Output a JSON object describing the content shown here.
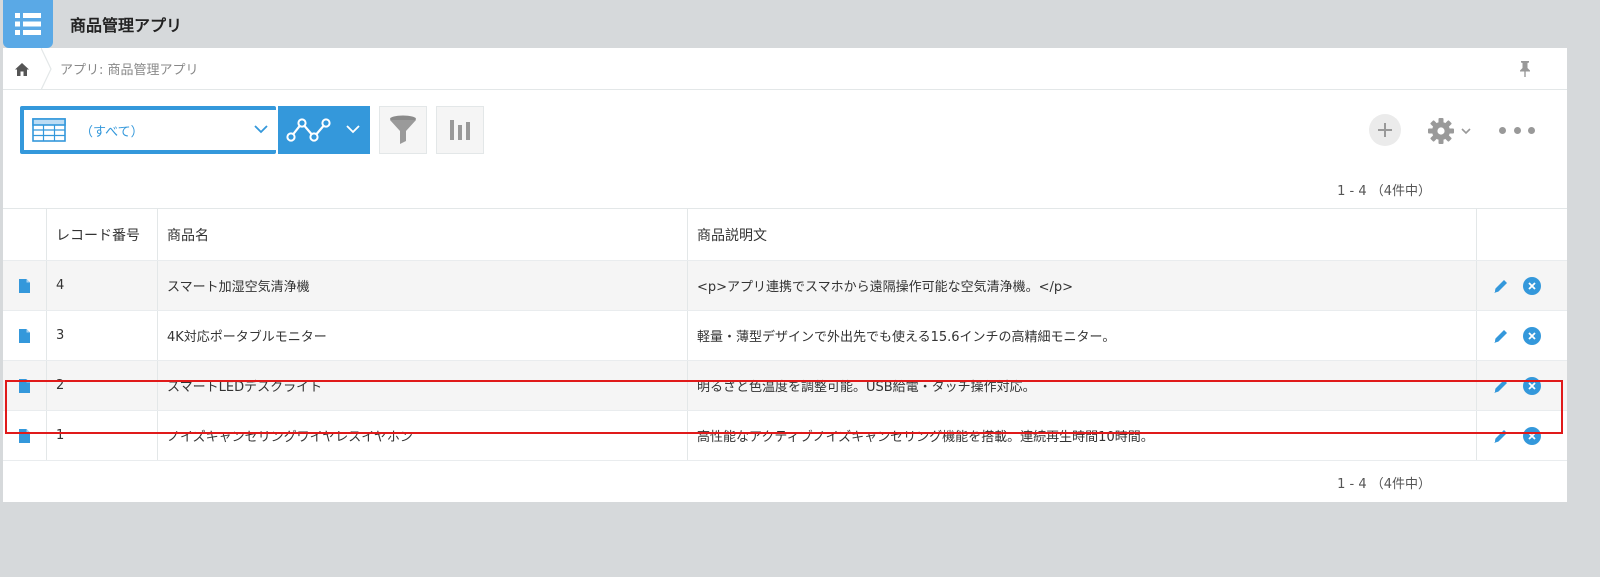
{
  "app": {
    "title": "商品管理アプリ"
  },
  "breadcrumb": {
    "text": "アプリ: 商品管理アプリ"
  },
  "toolbar": {
    "view_label": "（すべて）"
  },
  "pager": {
    "top": "1 - 4 （4件中）",
    "bottom": "1 - 4 （4件中）"
  },
  "table": {
    "headers": [
      "レコード番号",
      "商品名",
      "商品説明文"
    ],
    "rows": [
      {
        "id": "4",
        "name": "スマート加湿空気清浄機",
        "desc": "<p>アプリ連携でスマホから遠隔操作可能な空気清浄機。</p>"
      },
      {
        "id": "3",
        "name": "4K対応ポータブルモニター",
        "desc": "軽量・薄型デザインで外出先でも使える15.6インチの高精細モニター。"
      },
      {
        "id": "2",
        "name": "スマートLEDデスクライト",
        "desc": "明るさと色温度を調整可能。USB給電・タッチ操作対応。"
      },
      {
        "id": "1",
        "name": "ノイズキャンセリングワイヤレスイヤホン",
        "desc": "高性能なアクティブノイズキャンセリング機能を搭載。連続再生時間10時間。"
      }
    ]
  },
  "colors": {
    "accent": "#3498db",
    "highlight": "#e01a1a",
    "app_icon": "#5aa9e6"
  }
}
